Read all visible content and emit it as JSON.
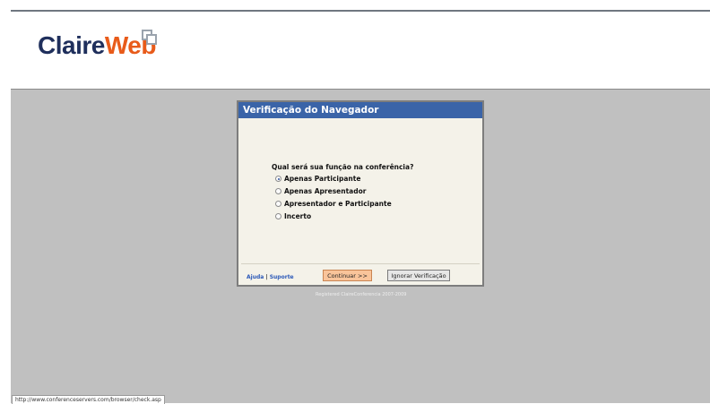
{
  "header": {
    "logo_part1": "Claire",
    "logo_part2": "Web",
    "logo_mark_icon": "overlapping-squares-icon"
  },
  "dialog": {
    "title": "Verificação do Navegador",
    "question": "Qual será sua função na conferência?",
    "options": [
      {
        "label": "Apenas Participante",
        "selected": true
      },
      {
        "label": "Apenas Apresentador",
        "selected": false
      },
      {
        "label": "Apresentador e Participante",
        "selected": false
      },
      {
        "label": "Incerto",
        "selected": false
      }
    ],
    "help_link": "Ajuda",
    "separator": "|",
    "support_link": "Suporte",
    "continue_button": "Continuar >>",
    "skip_button": "Ignorar Verificação"
  },
  "footer": {
    "registered": "Registered ClaireConferencia 2007-2009"
  },
  "statusbar": {
    "url": "http://www.conferenceservers.com/browser/check.asp"
  },
  "colors": {
    "title_bar": "#3a64a8",
    "logo_dark": "#1f2f5c",
    "logo_accent": "#e85b1a",
    "background_gray": "#c0c0c0"
  }
}
